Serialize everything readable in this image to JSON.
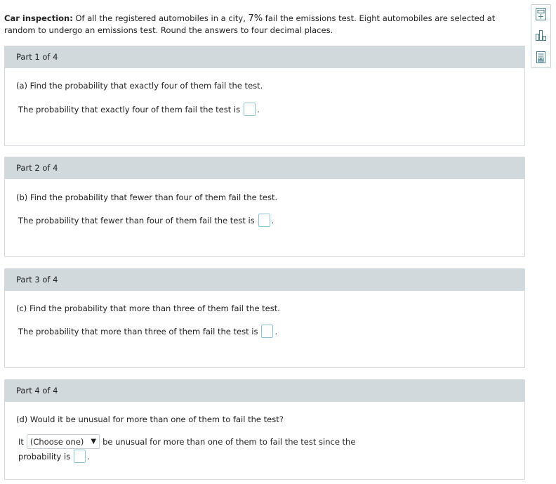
{
  "intro": {
    "label": "Car inspection:",
    "text_before_pct": " Of all the registered automobiles in a city, ",
    "pct": "7%",
    "text_after_pct": " fail the emissions test. Eight automobiles are selected at random to undergo an emissions test. Round the answers to four decimal places."
  },
  "side_tools": [
    {
      "icon": "calculator-icon"
    },
    {
      "icon": "bar-chart-icon"
    },
    {
      "icon": "table-icon"
    }
  ],
  "parts": [
    {
      "header": "Part 1 of 4",
      "question": "(a) Find the probability that exactly four of them fail the test.",
      "answer_prefix": "The probability that exactly four of them fail the test is",
      "answer_value": "",
      "suffix": "."
    },
    {
      "header": "Part 2 of 4",
      "question": "(b) Find the probability that fewer than four of them fail the test.",
      "answer_prefix": "The probability that fewer than four of them fail the test is",
      "answer_value": "",
      "suffix": "."
    },
    {
      "header": "Part 3 of 4",
      "question": "(c) Find the probability that more than three of them fail the test.",
      "answer_prefix": "The probability that more than three of them fail the test is",
      "answer_value": "",
      "suffix": "."
    },
    {
      "header": "Part 4 of 4",
      "question": "(d) Would it be unusual for more than one of them to fail the test?",
      "line1_before": "It",
      "select_value": "(Choose one)",
      "select_arrow": "▼",
      "line1_after": "be unusual for more than one of them to fail the test since the",
      "line2_prefix": "probability is",
      "answer_value": "",
      "suffix": "."
    }
  ]
}
